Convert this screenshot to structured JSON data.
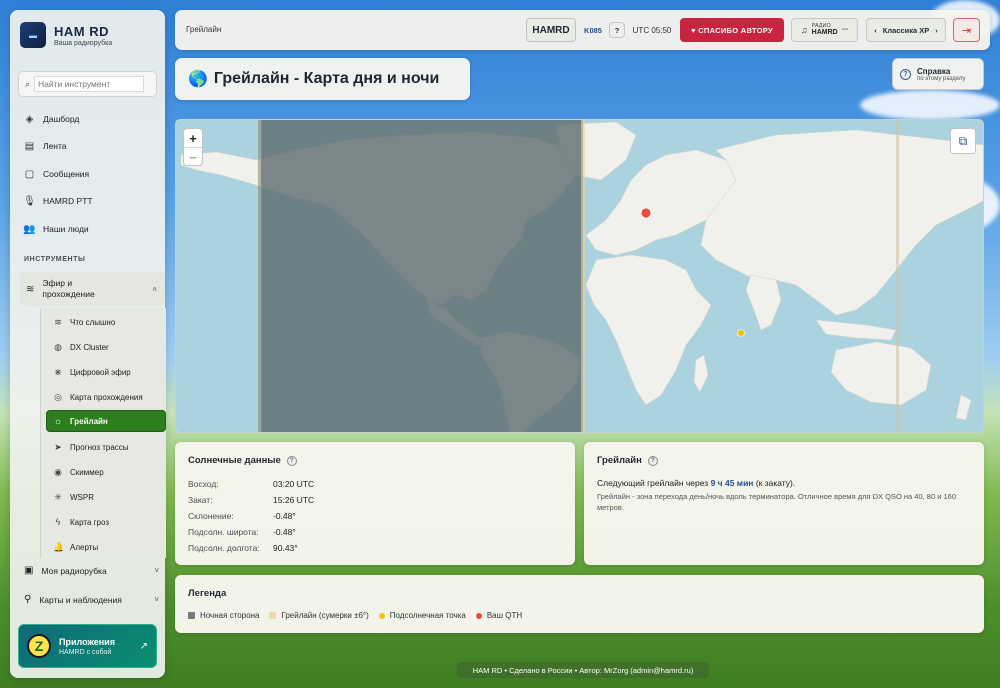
{
  "brand": {
    "title": "HAM RD",
    "subtitle": "Ваша радиорубка"
  },
  "search": {
    "placeholder": "Найти инструмент"
  },
  "nav": [
    {
      "label": "Дашборд",
      "icon": "layers-icon"
    },
    {
      "label": "Лента",
      "icon": "feed-icon"
    },
    {
      "label": "Сообщения",
      "icon": "message-icon"
    },
    {
      "label": "HAMRD PTT",
      "icon": "mic-icon"
    },
    {
      "label": "Наши люди",
      "icon": "users-icon"
    }
  ],
  "tools_section": "ИНСТРУМЕНТЫ",
  "group": {
    "label": "Эфир и прохождение",
    "icon": "wifi-icon"
  },
  "sub_items": [
    {
      "label": "Что слышно",
      "icon": "wifi-icon"
    },
    {
      "label": "DX Cluster",
      "icon": "globe-icon"
    },
    {
      "label": "Цифровой эфир",
      "icon": "digital-icon"
    },
    {
      "label": "Карта прохождения",
      "icon": "target-icon"
    },
    {
      "label": "Грейлайн",
      "icon": "sun-icon",
      "active": true
    },
    {
      "label": "Прогноз трассы",
      "icon": "send-icon"
    },
    {
      "label": "Скиммер",
      "icon": "eye-icon"
    },
    {
      "label": "WSPR",
      "icon": "antenna-icon"
    },
    {
      "label": "Карта гроз",
      "icon": "storm-icon"
    },
    {
      "label": "Алерты",
      "icon": "bell-icon"
    }
  ],
  "collapsed": [
    {
      "label": "Моя радиорубка"
    },
    {
      "label": "Карты и наблюдения"
    }
  ],
  "apps": {
    "title": "Приложения",
    "subtitle": "HAMRD с собой",
    "logo": "Z"
  },
  "topbar": {
    "breadcrumb": "Грейлайн",
    "badge": "HAMRD",
    "callsign": "K085",
    "help_q": "?",
    "utc": "UTC 05:50",
    "thanks": "♥ СПАСИБО АВТОРУ",
    "radio_top": "РАДИО",
    "radio_bottom": "HAMRD",
    "theme": "Классика XP"
  },
  "page": {
    "title": "Грейлайн - Карта дня и ночи",
    "globe": "🌎"
  },
  "help": {
    "title": "Справка",
    "subtitle": "по этому разделу"
  },
  "map": {
    "zoom_in": "+",
    "zoom_out": "−",
    "colors": {
      "night": "#5f6e72",
      "day_land": "#f0f0ec",
      "water": "#aad3df",
      "qth": "#e74c3c",
      "subsolar": "#f1c40f"
    }
  },
  "solar": {
    "title": "Солнечные данные",
    "rows": [
      {
        "label": "Восход:",
        "value": "03:20 UTC"
      },
      {
        "label": "Закат:",
        "value": "15:26 UTC"
      },
      {
        "label": "Склонение:",
        "value": "-0.48°"
      },
      {
        "label": "Подсолн. широта:",
        "value": "-0.48°"
      },
      {
        "label": "Подсолн. долгота:",
        "value": "90.43°"
      }
    ]
  },
  "greyline": {
    "title": "Грейлайн",
    "next_prefix": "Следующий грейлайн через",
    "next_time": "9 ч 45 мин",
    "next_suffix": "(к закату).",
    "description": "Грейлайн - зона перехода день/ночь вдоль терминатора. Отличное время для DX QSO на 40, 80 и 160 метров."
  },
  "legend": {
    "title": "Легенда",
    "items": [
      {
        "label": "Ночная сторона",
        "color": "#707a7c"
      },
      {
        "label": "Грейлайн (сумерки ±6°)",
        "color": "#f0d9a8"
      },
      {
        "label": "Подсолнечная точка",
        "color": "#f1c40f"
      },
      {
        "label": "Ваш QTH",
        "color": "#e74c3c"
      }
    ]
  },
  "footer": "HAM RD • Сделано в России • Автор: MrZorg (admin@hamrd.ru)"
}
